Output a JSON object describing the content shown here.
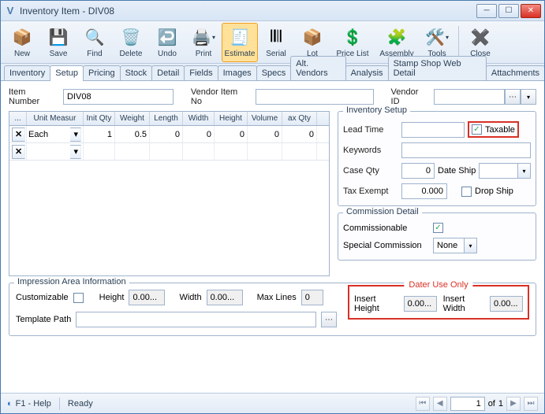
{
  "window": {
    "title": "Inventory Item - DIV08"
  },
  "toolbar": {
    "new": "New",
    "save": "Save",
    "find": "Find",
    "delete": "Delete",
    "undo": "Undo",
    "print": "Print",
    "estimate": "Estimate",
    "serial": "Serial",
    "lot": "Lot",
    "pricelist": "Price List",
    "assembly": "Assembly",
    "tools": "Tools",
    "close": "Close"
  },
  "tabs": [
    "Inventory",
    "Setup",
    "Pricing",
    "Stock",
    "Detail",
    "Fields",
    "Images",
    "Specs",
    "Alt. Vendors",
    "Analysis",
    "Stamp Shop Web Detail",
    "Attachments"
  ],
  "active_tab": 1,
  "header": {
    "item_number_label": "Item Number",
    "item_number": "DIV08",
    "vendor_item_label": "Vendor Item No",
    "vendor_item": "",
    "vendor_id_label": "Vendor ID",
    "vendor_id": ""
  },
  "grid": {
    "columns": [
      "...",
      "Unit Measur",
      "Init Qty",
      "Weight",
      "Length",
      "Width",
      "Height",
      "Volume",
      "ax Qty"
    ],
    "rows": [
      {
        "unit": "Each",
        "init_qty": "1",
        "weight": "0.5",
        "length": "0",
        "width": "0",
        "height": "0",
        "volume": "0",
        "ax_qty": "0"
      }
    ]
  },
  "inventory_setup": {
    "title": "Inventory Setup",
    "lead_time_label": "Lead Time",
    "lead_time": "",
    "taxable_label": "Taxable",
    "taxable_checked": true,
    "keywords_label": "Keywords",
    "keywords": "",
    "case_qty_label": "Case Qty",
    "case_qty": "0",
    "date_ship_label": "Date Ship",
    "date_ship": "",
    "tax_exempt_label": "Tax Exempt",
    "tax_exempt": "0.000",
    "drop_ship_label": "Drop Ship",
    "drop_ship_checked": false
  },
  "commission": {
    "title": "Commission Detail",
    "commissionable_label": "Commissionable",
    "commissionable_checked": true,
    "special_label": "Special Commission",
    "special_value": "None"
  },
  "impression": {
    "title": "Impression Area Information",
    "customizable_label": "Customizable",
    "customizable_checked": false,
    "height_label": "Height",
    "height": "0.00...",
    "width_label": "Width",
    "width": "0.00...",
    "max_lines_label": "Max Lines",
    "max_lines": "0",
    "template_path_label": "Template Path",
    "template_path": "",
    "dater_title": "Dater Use Only",
    "insert_height_label": "Insert Height",
    "insert_height": "0.00...",
    "insert_width_label": "Insert Width",
    "insert_width": "0.00..."
  },
  "status": {
    "help": "F1 - Help",
    "ready": "Ready",
    "page": "1",
    "of": "of",
    "total": "1"
  }
}
